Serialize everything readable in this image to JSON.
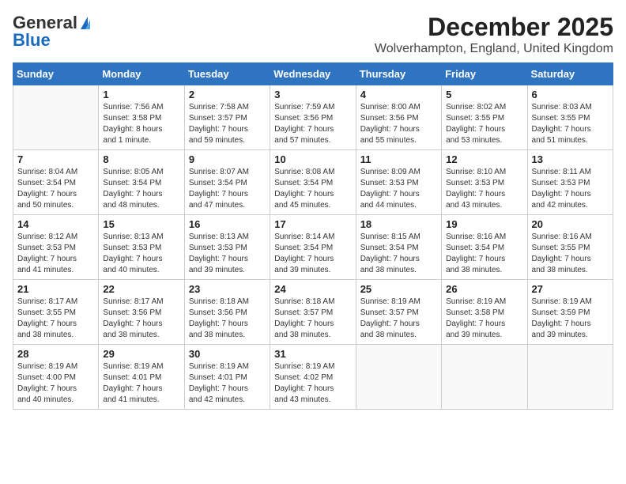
{
  "header": {
    "logo_line1": "General",
    "logo_line2": "Blue",
    "month": "December 2025",
    "location": "Wolverhampton, England, United Kingdom"
  },
  "weekdays": [
    "Sunday",
    "Monday",
    "Tuesday",
    "Wednesday",
    "Thursday",
    "Friday",
    "Saturday"
  ],
  "weeks": [
    [
      {
        "day": "",
        "info": ""
      },
      {
        "day": "1",
        "info": "Sunrise: 7:56 AM\nSunset: 3:58 PM\nDaylight: 8 hours\nand 1 minute."
      },
      {
        "day": "2",
        "info": "Sunrise: 7:58 AM\nSunset: 3:57 PM\nDaylight: 7 hours\nand 59 minutes."
      },
      {
        "day": "3",
        "info": "Sunrise: 7:59 AM\nSunset: 3:56 PM\nDaylight: 7 hours\nand 57 minutes."
      },
      {
        "day": "4",
        "info": "Sunrise: 8:00 AM\nSunset: 3:56 PM\nDaylight: 7 hours\nand 55 minutes."
      },
      {
        "day": "5",
        "info": "Sunrise: 8:02 AM\nSunset: 3:55 PM\nDaylight: 7 hours\nand 53 minutes."
      },
      {
        "day": "6",
        "info": "Sunrise: 8:03 AM\nSunset: 3:55 PM\nDaylight: 7 hours\nand 51 minutes."
      }
    ],
    [
      {
        "day": "7",
        "info": "Sunrise: 8:04 AM\nSunset: 3:54 PM\nDaylight: 7 hours\nand 50 minutes."
      },
      {
        "day": "8",
        "info": "Sunrise: 8:05 AM\nSunset: 3:54 PM\nDaylight: 7 hours\nand 48 minutes."
      },
      {
        "day": "9",
        "info": "Sunrise: 8:07 AM\nSunset: 3:54 PM\nDaylight: 7 hours\nand 47 minutes."
      },
      {
        "day": "10",
        "info": "Sunrise: 8:08 AM\nSunset: 3:54 PM\nDaylight: 7 hours\nand 45 minutes."
      },
      {
        "day": "11",
        "info": "Sunrise: 8:09 AM\nSunset: 3:53 PM\nDaylight: 7 hours\nand 44 minutes."
      },
      {
        "day": "12",
        "info": "Sunrise: 8:10 AM\nSunset: 3:53 PM\nDaylight: 7 hours\nand 43 minutes."
      },
      {
        "day": "13",
        "info": "Sunrise: 8:11 AM\nSunset: 3:53 PM\nDaylight: 7 hours\nand 42 minutes."
      }
    ],
    [
      {
        "day": "14",
        "info": "Sunrise: 8:12 AM\nSunset: 3:53 PM\nDaylight: 7 hours\nand 41 minutes."
      },
      {
        "day": "15",
        "info": "Sunrise: 8:13 AM\nSunset: 3:53 PM\nDaylight: 7 hours\nand 40 minutes."
      },
      {
        "day": "16",
        "info": "Sunrise: 8:13 AM\nSunset: 3:53 PM\nDaylight: 7 hours\nand 39 minutes."
      },
      {
        "day": "17",
        "info": "Sunrise: 8:14 AM\nSunset: 3:54 PM\nDaylight: 7 hours\nand 39 minutes."
      },
      {
        "day": "18",
        "info": "Sunrise: 8:15 AM\nSunset: 3:54 PM\nDaylight: 7 hours\nand 38 minutes."
      },
      {
        "day": "19",
        "info": "Sunrise: 8:16 AM\nSunset: 3:54 PM\nDaylight: 7 hours\nand 38 minutes."
      },
      {
        "day": "20",
        "info": "Sunrise: 8:16 AM\nSunset: 3:55 PM\nDaylight: 7 hours\nand 38 minutes."
      }
    ],
    [
      {
        "day": "21",
        "info": "Sunrise: 8:17 AM\nSunset: 3:55 PM\nDaylight: 7 hours\nand 38 minutes."
      },
      {
        "day": "22",
        "info": "Sunrise: 8:17 AM\nSunset: 3:56 PM\nDaylight: 7 hours\nand 38 minutes."
      },
      {
        "day": "23",
        "info": "Sunrise: 8:18 AM\nSunset: 3:56 PM\nDaylight: 7 hours\nand 38 minutes."
      },
      {
        "day": "24",
        "info": "Sunrise: 8:18 AM\nSunset: 3:57 PM\nDaylight: 7 hours\nand 38 minutes."
      },
      {
        "day": "25",
        "info": "Sunrise: 8:19 AM\nSunset: 3:57 PM\nDaylight: 7 hours\nand 38 minutes."
      },
      {
        "day": "26",
        "info": "Sunrise: 8:19 AM\nSunset: 3:58 PM\nDaylight: 7 hours\nand 39 minutes."
      },
      {
        "day": "27",
        "info": "Sunrise: 8:19 AM\nSunset: 3:59 PM\nDaylight: 7 hours\nand 39 minutes."
      }
    ],
    [
      {
        "day": "28",
        "info": "Sunrise: 8:19 AM\nSunset: 4:00 PM\nDaylight: 7 hours\nand 40 minutes."
      },
      {
        "day": "29",
        "info": "Sunrise: 8:19 AM\nSunset: 4:01 PM\nDaylight: 7 hours\nand 41 minutes."
      },
      {
        "day": "30",
        "info": "Sunrise: 8:19 AM\nSunset: 4:01 PM\nDaylight: 7 hours\nand 42 minutes."
      },
      {
        "day": "31",
        "info": "Sunrise: 8:19 AM\nSunset: 4:02 PM\nDaylight: 7 hours\nand 43 minutes."
      },
      {
        "day": "",
        "info": ""
      },
      {
        "day": "",
        "info": ""
      },
      {
        "day": "",
        "info": ""
      }
    ]
  ]
}
